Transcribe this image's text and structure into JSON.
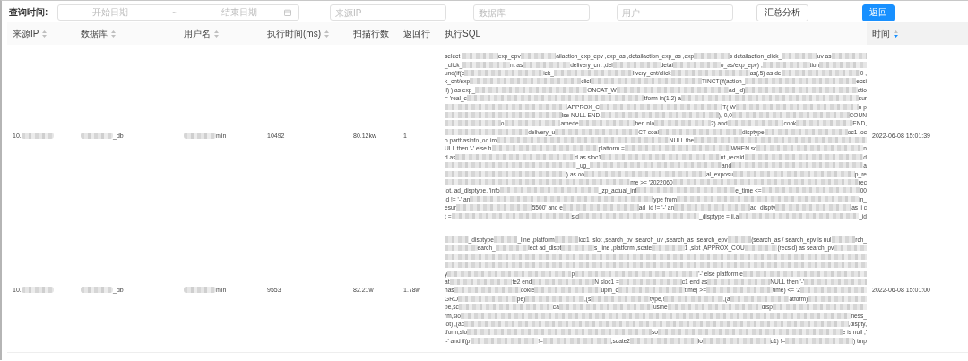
{
  "filters": {
    "label": "查询时间:",
    "date_range": {
      "start_placeholder": "开始日期",
      "separator": "~",
      "end_placeholder": "结束日期"
    },
    "inputs": [
      {
        "placeholder": "来源IP"
      },
      {
        "placeholder": "数据库"
      },
      {
        "placeholder": "用户"
      }
    ],
    "buttons": [
      {
        "label": "汇总分析",
        "kind": "default"
      },
      {
        "label": "返回",
        "kind": "primary"
      }
    ]
  },
  "table": {
    "columns": [
      {
        "label": "来源IP",
        "sortable": true,
        "sorted_descending": false
      },
      {
        "label": "数据库",
        "sortable": true,
        "sorted_descending": false
      },
      {
        "label": "用户名",
        "sortable": true,
        "sorted_descending": false
      },
      {
        "label": "执行时间(ms)",
        "sortable": true,
        "sorted_descending": false
      },
      {
        "label": "扫描行数",
        "sortable": false
      },
      {
        "label": "返回行",
        "sortable": false
      },
      {
        "label": "执行SQL",
        "sortable": false
      },
      {
        "label": "时间",
        "sortable": true,
        "sorted_descending": true
      }
    ],
    "rows": [
      {
        "source_ip": [
          {
            "kind": "text",
            "text": "10."
          },
          {
            "kind": "mask"
          }
        ],
        "database": [
          {
            "kind": "mask"
          },
          {
            "kind": "text",
            "text": "_db"
          }
        ],
        "user": [
          {
            "kind": "mask"
          },
          {
            "kind": "text",
            "text": "min"
          }
        ],
        "exec_ms": "10492",
        "scanned": "80.12kw",
        "returned": "1",
        "time": "2022-06-08 15:01:39",
        "sql": [
          [
            {
              "kind": "text",
              "text": "select '"
            },
            {
              "kind": "mask"
            },
            {
              "kind": "text",
              "text": "exp_epv"
            },
            {
              "kind": "mask"
            },
            {
              "kind": "text",
              "text": "ailaction_exp_epv ,exp_as ,detailaction_exp_as ,exp"
            },
            {
              "kind": "mask"
            },
            {
              "kind": "text",
              "text": "s detailaction_click_"
            },
            {
              "kind": "mask"
            },
            {
              "kind": "text",
              "text": "uv as"
            },
            {
              "kind": "mask"
            }
          ],
          [
            {
              "kind": "text",
              "text": "_click_"
            },
            {
              "kind": "mask"
            },
            {
              "kind": "text",
              "text": "nt as"
            },
            {
              "kind": "mask"
            },
            {
              "kind": "text",
              "text": "delivery_cnt ,del"
            },
            {
              "kind": "mask"
            },
            {
              "kind": "text",
              "text": "detai"
            },
            {
              "kind": "mask"
            },
            {
              "kind": "text",
              "text": "o_as/exp_epv) ,"
            },
            {
              "kind": "mask"
            },
            {
              "kind": "text",
              "text": "tion"
            },
            {
              "kind": "mask"
            }
          ],
          [
            {
              "kind": "text",
              "text": "und(if(c"
            },
            {
              "kind": "mask"
            },
            {
              "kind": "text",
              "text": "ick_"
            },
            {
              "kind": "mask"
            },
            {
              "kind": "text",
              "text": "livery_cnt/click"
            },
            {
              "kind": "mask"
            },
            {
              "kind": "text",
              "text": "as(,5) as de"
            },
            {
              "kind": "mask"
            },
            {
              "kind": "text",
              "text": "0 ,"
            }
          ],
          [
            {
              "kind": "text",
              "text": "k_cnt/exp"
            },
            {
              "kind": "mask"
            },
            {
              "kind": "text",
              "text": "clicl"
            },
            {
              "kind": "mask"
            },
            {
              "kind": "text",
              "text": "TINCT(if(action_"
            },
            {
              "kind": "mask"
            },
            {
              "kind": "text",
              "text": "ecsi"
            }
          ],
          [
            {
              "kind": "text",
              "text": "ll) ) as exp_"
            },
            {
              "kind": "mask"
            },
            {
              "kind": "text",
              "text": "ONCAT_W"
            },
            {
              "kind": "mask"
            },
            {
              "kind": "text",
              "text": "ad_id)"
            },
            {
              "kind": "mask"
            },
            {
              "kind": "text",
              "text": "ctio"
            }
          ],
          [
            {
              "kind": "text",
              "text": "= 'real_c"
            },
            {
              "kind": "mask"
            },
            {
              "kind": "text",
              "text": "tform in(1,2) a"
            },
            {
              "kind": "mask"
            },
            {
              "kind": "text",
              "text": "sur"
            }
          ],
          [
            {
              "kind": "mask"
            },
            {
              "kind": "text",
              "text": "APPROX_C"
            },
            {
              "kind": "mask"
            },
            {
              "kind": "text",
              "text": "T( W"
            },
            {
              "kind": "mask"
            },
            {
              "kind": "text",
              "text": "n p"
            }
          ],
          [
            {
              "kind": "mask"
            },
            {
              "kind": "text",
              "text": "lse NULL END,"
            },
            {
              "kind": "mask"
            },
            {
              "kind": "text",
              "text": "), 0,0"
            },
            {
              "kind": "mask"
            },
            {
              "kind": "text",
              "text": "COUN"
            }
          ],
          [
            {
              "kind": "mask"
            },
            {
              "kind": "text",
              "text": "o"
            },
            {
              "kind": "mask"
            },
            {
              "kind": "text",
              "text": "amede"
            },
            {
              "kind": "mask"
            },
            {
              "kind": "text",
              "text": "hen nlo"
            },
            {
              "kind": "mask"
            },
            {
              "kind": "text",
              "text": "2) and"
            },
            {
              "kind": "mask"
            },
            {
              "kind": "text",
              "text": "cook"
            },
            {
              "kind": "mask"
            },
            {
              "kind": "text",
              "text": "END,"
            }
          ],
          [
            {
              "kind": "mask"
            },
            {
              "kind": "text",
              "text": "delivery_u"
            },
            {
              "kind": "mask"
            },
            {
              "kind": "text",
              "text": "CT coal"
            },
            {
              "kind": "mask"
            },
            {
              "kind": "text",
              "text": "disptype"
            },
            {
              "kind": "mask"
            },
            {
              "kind": "text",
              "text": "oc1 ,oc"
            }
          ],
          [
            {
              "kind": "text",
              "text": "o.parthasinfo ,oo.im"
            },
            {
              "kind": "mask"
            },
            {
              "kind": "text",
              "text": "NULL the"
            },
            {
              "kind": "mask"
            }
          ],
          [
            {
              "kind": "text",
              "text": "ULL then '-' else h"
            },
            {
              "kind": "mask"
            },
            {
              "kind": "text",
              "text": "platform ="
            },
            {
              "kind": "mask"
            },
            {
              "kind": "text",
              "text": "WHEN sc"
            },
            {
              "kind": "mask"
            },
            {
              "kind": "text",
              "text": "n"
            }
          ],
          [
            {
              "kind": "text",
              "text": "d as"
            },
            {
              "kind": "mask"
            },
            {
              "kind": "text",
              "text": "d as sloc1"
            },
            {
              "kind": "mask"
            },
            {
              "kind": "text",
              "text": "nt ,recsid"
            },
            {
              "kind": "mask"
            },
            {
              "kind": "text",
              "text": "d"
            }
          ],
          [
            {
              "kind": "mask"
            },
            {
              "kind": "text",
              "text": "_ug_"
            },
            {
              "kind": "mask"
            },
            {
              "kind": "text",
              "text": "and"
            },
            {
              "kind": "mask"
            },
            {
              "kind": "text",
              "text": "a"
            }
          ],
          [
            {
              "kind": "mask"
            },
            {
              "kind": "text",
              "text": ") as oo"
            },
            {
              "kind": "mask"
            },
            {
              "kind": "text",
              "text": "al_exposu"
            },
            {
              "kind": "mask"
            },
            {
              "kind": "text",
              "text": "p_re"
            }
          ],
          [
            {
              "kind": "mask"
            },
            {
              "kind": "text",
              "text": "me >= '2022060"
            },
            {
              "kind": "mask"
            },
            {
              "kind": "text",
              "text": "rec"
            }
          ],
          [
            {
              "kind": "text",
              "text": "lot, ad_disptype, 'info"
            },
            {
              "kind": "mask"
            },
            {
              "kind": "text",
              "text": "_zp_actual_inf"
            },
            {
              "kind": "mask"
            },
            {
              "kind": "text",
              "text": "e_time <="
            },
            {
              "kind": "mask"
            },
            {
              "kind": "text",
              "text": "00"
            }
          ],
          [
            {
              "kind": "text",
              "text": "id != '-' an"
            },
            {
              "kind": "mask"
            },
            {
              "kind": "text",
              "text": "type from"
            },
            {
              "kind": "mask"
            },
            {
              "kind": "text",
              "text": "in_"
            }
          ],
          [
            {
              "kind": "text",
              "text": "esur"
            },
            {
              "kind": "mask"
            },
            {
              "kind": "text",
              "text": "5500' and e"
            },
            {
              "kind": "mask"
            },
            {
              "kind": "text",
              "text": "ad_id != '-' an"
            },
            {
              "kind": "mask"
            },
            {
              "kind": "text",
              "text": "ad_dispty"
            },
            {
              "kind": "mask"
            },
            {
              "kind": "text",
              "text": "as ii c"
            }
          ],
          [
            {
              "kind": "text",
              "text": "t ="
            },
            {
              "kind": "mask"
            },
            {
              "kind": "text",
              "text": "sid"
            },
            {
              "kind": "mask"
            },
            {
              "kind": "text",
              "text": "_disptype = ii.a"
            },
            {
              "kind": "mask"
            },
            {
              "kind": "text",
              "text": "_id"
            }
          ]
        ]
      },
      {
        "source_ip": [
          {
            "kind": "text",
            "text": "10."
          },
          {
            "kind": "mask"
          }
        ],
        "database": [
          {
            "kind": "mask"
          },
          {
            "kind": "text",
            "text": "_db"
          }
        ],
        "user": [
          {
            "kind": "mask"
          },
          {
            "kind": "text",
            "text": "min"
          }
        ],
        "exec_ms": "9553",
        "scanned": "82.21w",
        "returned": "1.78w",
        "time": "2022-06-08 15:01:00",
        "sql": [
          [
            {
              "kind": "mask"
            },
            {
              "kind": "text",
              "text": "_disptype"
            },
            {
              "kind": "mask"
            },
            {
              "kind": "text",
              "text": "_line ,platform"
            },
            {
              "kind": "mask"
            },
            {
              "kind": "text",
              "text": "loc1 ,slot ,search_pv ,search_uv ,search_as ,search_epv"
            },
            {
              "kind": "mask"
            },
            {
              "kind": "text",
              "text": "(search_as / search_epv is nul"
            },
            {
              "kind": "mask"
            },
            {
              "kind": "text",
              "text": "rch_"
            }
          ],
          [
            {
              "kind": "mask"
            },
            {
              "kind": "text",
              "text": "earch_"
            },
            {
              "kind": "mask"
            },
            {
              "kind": "text",
              "text": "lect ad_dispt"
            },
            {
              "kind": "mask"
            },
            {
              "kind": "text",
              "text": "s_line ,platform ,scate"
            },
            {
              "kind": "mask"
            },
            {
              "kind": "text",
              "text": "1 ,slot ,APPROX_COU"
            },
            {
              "kind": "mask"
            },
            {
              "kind": "text",
              "text": "(recsid) as search_pv"
            },
            {
              "kind": "mask"
            }
          ],
          [
            {
              "kind": "mask"
            }
          ],
          [
            {
              "kind": "mask"
            }
          ],
          [
            {
              "kind": "text",
              "text": "y"
            },
            {
              "kind": "mask"
            },
            {
              "kind": "text",
              "text": "p"
            },
            {
              "kind": "mask"
            },
            {
              "kind": "text",
              "text": "'-' else platform e"
            },
            {
              "kind": "mask"
            }
          ],
          [
            {
              "kind": "text",
              "text": "at"
            },
            {
              "kind": "mask"
            },
            {
              "kind": "text",
              "text": "te2 end"
            },
            {
              "kind": "mask"
            },
            {
              "kind": "text",
              "text": "N sloc1 ="
            },
            {
              "kind": "mask"
            },
            {
              "kind": "text",
              "text": "c1 end as"
            },
            {
              "kind": "mask"
            },
            {
              "kind": "text",
              "text": "NULL then '-'"
            },
            {
              "kind": "mask"
            }
          ],
          [
            {
              "kind": "text",
              "text": "has"
            },
            {
              "kind": "mask"
            },
            {
              "kind": "text",
              "text": "ookie"
            },
            {
              "kind": "mask"
            },
            {
              "kind": "text",
              "text": "upin_c"
            },
            {
              "kind": "mask"
            },
            {
              "kind": "text",
              "text": "time) >="
            },
            {
              "kind": "mask"
            },
            {
              "kind": "text",
              "text": "time) <= '2"
            },
            {
              "kind": "mask"
            }
          ],
          [
            {
              "kind": "text",
              "text": "GRO"
            },
            {
              "kind": "mask"
            },
            {
              "kind": "text",
              "text": "pe)"
            },
            {
              "kind": "mask"
            },
            {
              "kind": "text",
              "text": ",(s"
            },
            {
              "kind": "mask"
            },
            {
              "kind": "text",
              "text": "type,!"
            },
            {
              "kind": "mask"
            },
            {
              "kind": "text",
              "text": ",(a"
            },
            {
              "kind": "mask"
            },
            {
              "kind": "text",
              "text": "atform)"
            },
            {
              "kind": "mask"
            }
          ],
          [
            {
              "kind": "text",
              "text": "pe,sc"
            },
            {
              "kind": "mask"
            },
            {
              "kind": "text",
              "text": "ca"
            },
            {
              "kind": "mask"
            },
            {
              "kind": "text",
              "text": "usine"
            },
            {
              "kind": "mask"
            },
            {
              "kind": "text",
              "text": "disp"
            },
            {
              "kind": "mask"
            }
          ],
          [
            {
              "kind": "text",
              "text": "rm,slo"
            },
            {
              "kind": "mask"
            },
            {
              "kind": "text",
              "text": "ness_"
            }
          ],
          [
            {
              "kind": "text",
              "text": "lot) ,(ac"
            },
            {
              "kind": "mask"
            },
            {
              "kind": "text",
              "text": ",dispty,"
            }
          ],
          [
            {
              "kind": "text",
              "text": "tform,slo"
            },
            {
              "kind": "mask"
            },
            {
              "kind": "text",
              "text": "so"
            },
            {
              "kind": "mask"
            },
            {
              "kind": "text",
              "text": "e is null ,'"
            }
          ],
          [
            {
              "kind": "text",
              "text": "'-' and if(p"
            },
            {
              "kind": "mask"
            },
            {
              "kind": "text",
              "text": "!="
            },
            {
              "kind": "mask"
            },
            {
              "kind": "text",
              "text": ",scate2"
            },
            {
              "kind": "mask"
            },
            {
              "kind": "text",
              "text": "lo"
            },
            {
              "kind": "mask"
            },
            {
              "kind": "text",
              "text": "c1) !="
            },
            {
              "kind": "mask"
            },
            {
              "kind": "text",
              "text": ") tmp"
            }
          ]
        ]
      }
    ]
  }
}
